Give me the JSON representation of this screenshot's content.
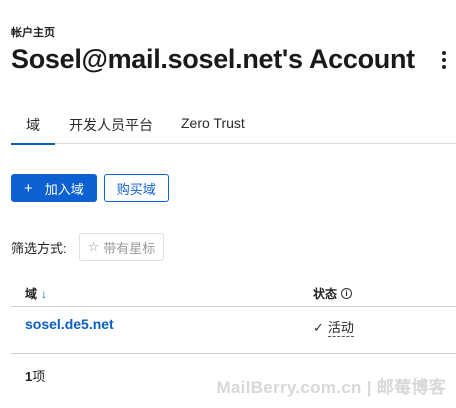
{
  "breadcrumb": "帐户主页",
  "page_title": "Sosel@mail.sosel.net's Account",
  "tabs": [
    {
      "label": "域",
      "active": true
    },
    {
      "label": "开发人员平台",
      "active": false
    },
    {
      "label": "Zero Trust",
      "active": false
    }
  ],
  "actions": {
    "add_domain": "加入域",
    "buy_domain": "购买域"
  },
  "filter": {
    "label": "筛选方式:",
    "starred_label": "带有星标"
  },
  "table": {
    "headers": {
      "domain": "域",
      "status": "状态"
    },
    "rows": [
      {
        "domain": "sosel.de5.net",
        "status": "活动"
      }
    ]
  },
  "item_count": {
    "number": "1",
    "unit": "项"
  },
  "watermark": "MailBerry.com.cn | 邮莓博客",
  "colors": {
    "accent": "#0b61d2",
    "link": "#0a5fc4"
  }
}
